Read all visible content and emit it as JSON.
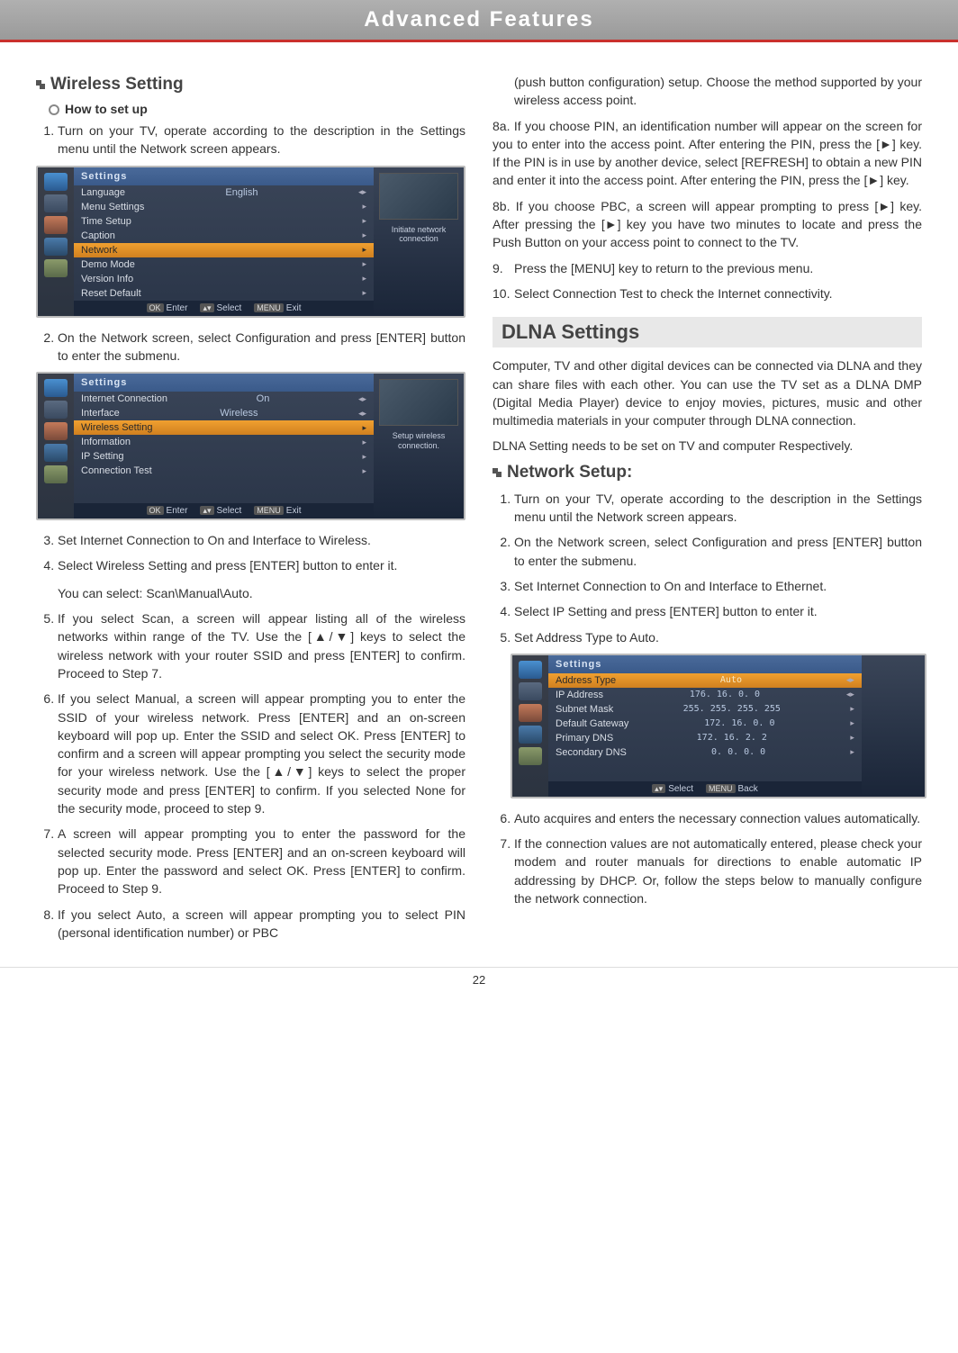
{
  "page": {
    "header": "Advanced Features",
    "number": "22"
  },
  "left": {
    "title": "Wireless Setting",
    "sub": "How to set up",
    "steps": {
      "s1": "Turn on your TV, operate according to the description in the Settings menu until the Network screen appears.",
      "s2": "On the Network screen, select Configuration and press [ENTER] button to enter the submenu.",
      "s3": "Set Internet Connection to On and Interface to Wireless.",
      "s4": "Select Wireless Setting and press [ENTER] button to enter it.",
      "s4b": "You can select: Scan\\Manual\\Auto.",
      "s5": "If you select Scan, a screen will appear listing all of the wireless networks within range of the TV. Use the [▲/▼] keys to select the wireless network with your router SSID and press [ENTER] to confirm. Proceed to Step 7.",
      "s6": "If you select Manual, a screen will appear prompting you to enter the SSID of your wireless network. Press [ENTER] and an on-screen keyboard will pop up.  Enter the SSID and select OK. Press [ENTER] to confirm and a screen will appear prompting you select the security mode for your wireless network. Use the [▲/▼] keys to select the proper security mode and press [ENTER] to confirm. If you selected None for the security mode, proceed to step 9.",
      "s7": "A screen will appear prompting you to enter the password for the selected security mode. Press [ENTER] and an on-screen keyboard will pop up. Enter the password and select OK. Press [ENTER] to confirm. Proceed to Step 9.",
      "s8": "If you select Auto, a screen will appear prompting you to select PIN (personal identification number) or PBC"
    },
    "menu1": {
      "title": "Settings",
      "rows": [
        {
          "label": "Language",
          "val": "English",
          "arr": "◂▸"
        },
        {
          "label": "Menu Settings",
          "arr": "▸"
        },
        {
          "label": "Time Setup",
          "arr": "▸"
        },
        {
          "label": "Caption",
          "arr": "▸"
        },
        {
          "label": "Network",
          "arr": "▸",
          "sel": true
        },
        {
          "label": "Demo Mode",
          "arr": "▸"
        },
        {
          "label": "Version Info",
          "arr": "▸"
        },
        {
          "label": "Reset Default",
          "arr": "▸"
        }
      ],
      "hint": "Initiate network connection",
      "footer": {
        "ok": "OK",
        "enter": "Enter",
        "sel": "Select",
        "menu": "MENU",
        "exit": "Exit"
      }
    },
    "menu2": {
      "title": "Settings",
      "rows": [
        {
          "label": "Internet Connection",
          "val": "On",
          "arr": "◂▸"
        },
        {
          "label": "Interface",
          "val": "Wireless",
          "arr": "◂▸"
        },
        {
          "label": "Wireless Setting",
          "arr": "▸",
          "sel": true
        },
        {
          "label": "Information",
          "arr": "▸"
        },
        {
          "label": "IP Setting",
          "arr": "▸"
        },
        {
          "label": "Connection Test",
          "arr": "▸"
        }
      ],
      "hint": "Setup wireless connection.",
      "footer": {
        "ok": "OK",
        "enter": "Enter",
        "sel": "Select",
        "menu": "MENU",
        "exit": "Exit"
      }
    }
  },
  "right": {
    "cont": "(push button configuration) setup. Choose the method supported by your wireless access point.",
    "s8a": "8a. If you choose PIN, an identification number will appear on the screen for you to enter into the access point. After entering the PIN, press the [►] key. If the PIN is in use by another device, select [REFRESH] to obtain a new PIN and enter it into the access point. After entering the PIN, press the [►] key.",
    "s8b": "8b. If you choose PBC, a screen will appear prompting to press [►] key. After pressing the [►] key you have two minutes to locate and press the Push Button on your access point to connect to the TV.",
    "s9n": "9.",
    "s9": "Press the [MENU] key to return to the previous menu.",
    "s10n": "10.",
    "s10": "Select Connection Test to check the Internet connectivity.",
    "dlna_title": "DLNA Settings",
    "dlna_p1": "Computer, TV and other digital devices can be connected via DLNA and they can share files with each other. You can use the TV set as a DLNA DMP (Digital Media Player) device to enjoy movies, pictures, music and other multimedia materials in your computer through DLNA connection.",
    "dlna_p2": "DLNA Setting needs to be set on TV and computer Respectively.",
    "net_title": "Network Setup:",
    "net": {
      "n1": "Turn on your TV, operate according to the description in the Settings menu until the Network screen appears.",
      "n2": "On the Network screen, select Configuration and press [ENTER] button to enter the submenu.",
      "n3": "Set Internet Connection to On and Interface to Ethernet.",
      "n4": "Select IP Setting and press [ENTER] button to enter it.",
      "n5": "Set Address Type to Auto.",
      "n6": "Auto acquires and enters the necessary connection values automatically.",
      "n7": "If the connection values are not automatically entered, please check your modem and router manuals for directions to enable automatic IP addressing by DHCP. Or, follow the steps below to manually configure the network connection."
    },
    "menu3": {
      "title": "Settings",
      "rows": [
        {
          "label": "Address Type",
          "val": "Auto",
          "arr": "◂▸",
          "sel": true
        },
        {
          "label": "IP Address",
          "ip": [
            "176.",
            "16.",
            "0.",
            "0"
          ],
          "arr": "◂▸"
        },
        {
          "label": "Subnet Mask",
          "ip": [
            "255.",
            "255.",
            "255.",
            "255"
          ],
          "arr": "▸"
        },
        {
          "label": "Default Gateway",
          "ip": [
            "172.",
            "16.",
            "0.",
            "0"
          ],
          "arr": "▸"
        },
        {
          "label": "Primary DNS",
          "ip": [
            "172.",
            "16.",
            "2.",
            "2"
          ],
          "arr": "▸"
        },
        {
          "label": "Secondary DNS",
          "ip": [
            "0.",
            "0.",
            "0.",
            "0"
          ],
          "arr": "▸"
        }
      ],
      "footer": {
        "sel": "Select",
        "menu": "MENU",
        "back": "Back"
      }
    }
  }
}
